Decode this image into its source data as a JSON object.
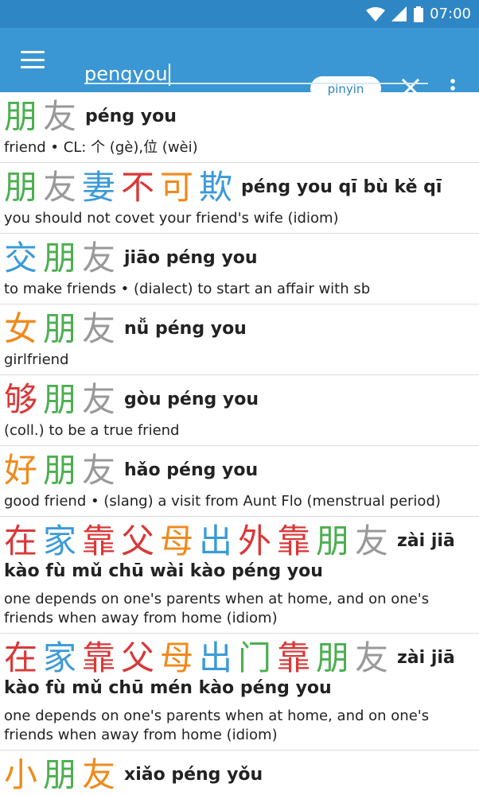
{
  "status": {
    "time": "07:00"
  },
  "toolbar": {
    "search_value": "pengyou",
    "mode_label": "pinyin"
  },
  "colors": {
    "tone1": "#3a9ad9",
    "tone2": "#4caf50",
    "tone3": "#f08a1c",
    "tone4": "#d93838",
    "neutral": "#999999"
  },
  "entries": [
    {
      "chars": [
        {
          "c": "朋",
          "t": 2
        },
        {
          "c": "友",
          "t": 5
        }
      ],
      "pinyin": "péng you",
      "definition": "friend • CL: 个 (gè),位 (wèi)"
    },
    {
      "chars": [
        {
          "c": "朋",
          "t": 2
        },
        {
          "c": "友",
          "t": 5
        },
        {
          "c": "妻",
          "t": 1
        },
        {
          "c": "不",
          "t": 4
        },
        {
          "c": "可",
          "t": 3
        },
        {
          "c": "欺",
          "t": 1
        }
      ],
      "pinyin": "péng you qī bù kě qī",
      "definition": "you should not covet your friend's wife (idiom)"
    },
    {
      "chars": [
        {
          "c": "交",
          "t": 1
        },
        {
          "c": "朋",
          "t": 2
        },
        {
          "c": "友",
          "t": 5
        }
      ],
      "pinyin": "jiāo péng you",
      "definition": "to make friends • (dialect) to start an affair with sb"
    },
    {
      "chars": [
        {
          "c": "女",
          "t": 3
        },
        {
          "c": "朋",
          "t": 2
        },
        {
          "c": "友",
          "t": 5
        }
      ],
      "pinyin": "nǚ péng you",
      "definition": "girlfriend"
    },
    {
      "chars": [
        {
          "c": "够",
          "t": 4
        },
        {
          "c": "朋",
          "t": 2
        },
        {
          "c": "友",
          "t": 5
        }
      ],
      "pinyin": "gòu péng you",
      "definition": "(coll.) to be a true friend"
    },
    {
      "chars": [
        {
          "c": "好",
          "t": 3
        },
        {
          "c": "朋",
          "t": 2
        },
        {
          "c": "友",
          "t": 5
        }
      ],
      "pinyin": "hǎo péng you",
      "definition": "good friend • (slang) a visit from Aunt Flo (menstrual period)"
    },
    {
      "chars": [
        {
          "c": "在",
          "t": 4
        },
        {
          "c": "家",
          "t": 1
        },
        {
          "c": "靠",
          "t": 4
        },
        {
          "c": "父",
          "t": 4
        },
        {
          "c": "母",
          "t": 3
        },
        {
          "c": "出",
          "t": 1
        },
        {
          "c": "外",
          "t": 4
        },
        {
          "c": "靠",
          "t": 4
        },
        {
          "c": "朋",
          "t": 2
        },
        {
          "c": "友",
          "t": 5
        }
      ],
      "pinyin_inline": "zài jiā",
      "pinyin": "kào fù mǔ chū wài kào péng you",
      "definition": "one depends on one's parents when at home, and on one's friends when away from home (idiom)"
    },
    {
      "chars": [
        {
          "c": "在",
          "t": 4
        },
        {
          "c": "家",
          "t": 1
        },
        {
          "c": "靠",
          "t": 4
        },
        {
          "c": "父",
          "t": 4
        },
        {
          "c": "母",
          "t": 3
        },
        {
          "c": "出",
          "t": 1
        },
        {
          "c": "门",
          "t": 2
        },
        {
          "c": "靠",
          "t": 4
        },
        {
          "c": "朋",
          "t": 2
        },
        {
          "c": "友",
          "t": 5
        }
      ],
      "pinyin_inline": "zài jiā",
      "pinyin": "kào fù mǔ chū mén kào péng you",
      "definition": "one depends on one's parents when at home, and on one's friends when away from home (idiom)"
    },
    {
      "chars": [
        {
          "c": "小",
          "t": 3
        },
        {
          "c": "朋",
          "t": 2
        },
        {
          "c": "友",
          "t": 3
        }
      ],
      "pinyin": "xiǎo péng yǒu",
      "definition": ""
    }
  ]
}
